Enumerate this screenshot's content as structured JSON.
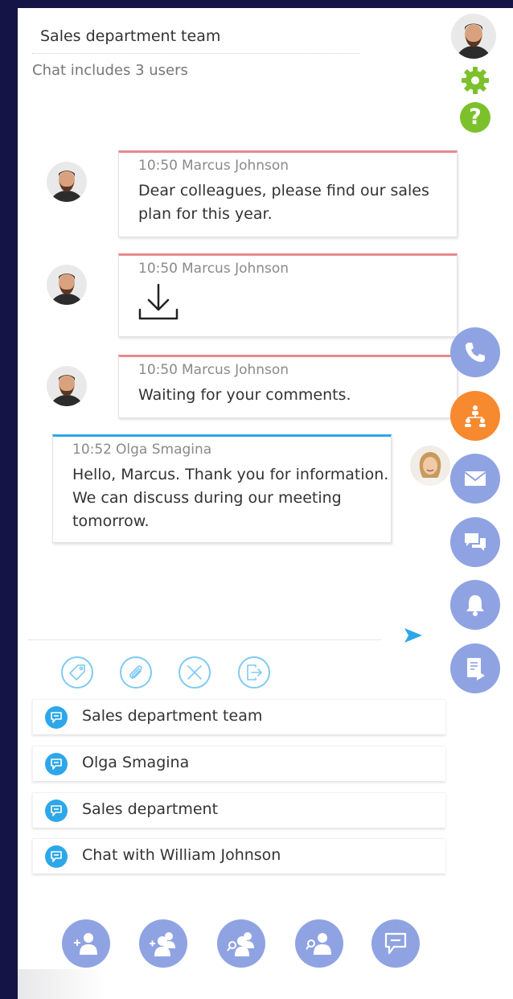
{
  "chat": {
    "title": "Sales department team",
    "info": "Chat includes 3 users"
  },
  "messages": [
    {
      "time": "10:50",
      "author": "Marcus Johnson",
      "text_lines": [
        "Dear colleagues, please find our sales",
        "plan for this year."
      ],
      "direction": "incoming"
    },
    {
      "time": "10:50",
      "author": "Marcus Johnson",
      "attachment": "download-icon",
      "direction": "incoming"
    },
    {
      "time": "10:50",
      "author": "Marcus Johnson",
      "text_lines": [
        "Waiting for your comments."
      ],
      "direction": "incoming"
    },
    {
      "time": "10:52",
      "author": "Olga Smagina",
      "text_lines": [
        "Hello, Marcus. Thank you for information.",
        "We can discuss during our meeting",
        "tomorrow."
      ],
      "direction": "outgoing"
    }
  ],
  "toolbar": [
    "tag-icon",
    "paperclip-icon",
    "close-icon",
    "exit-icon"
  ],
  "conversations": [
    {
      "label": "Sales department team",
      "icon": "chat-icon"
    },
    {
      "label": "Olga Smagina",
      "icon": "chat-icon"
    },
    {
      "label": "Sales department",
      "icon": "chat-icon"
    },
    {
      "label": "Chat with William Johnson",
      "icon": "chat-icon"
    }
  ],
  "side_nav": [
    "phone-icon",
    "org-structure-icon",
    "mail-icon",
    "chats-icon",
    "bell-icon",
    "tasks-icon"
  ],
  "bottom_actions": [
    "add-user-icon",
    "add-group-icon",
    "search-group-icon",
    "search-user-icon",
    "new-chat-icon"
  ],
  "colors": {
    "background": "#141447",
    "incoming_accent": "#e78a8e",
    "outgoing_accent": "#2ea7e8",
    "nav_button": "#8fa3e3",
    "nav_active": "#f7892f",
    "settings_green": "#7cc12b"
  }
}
